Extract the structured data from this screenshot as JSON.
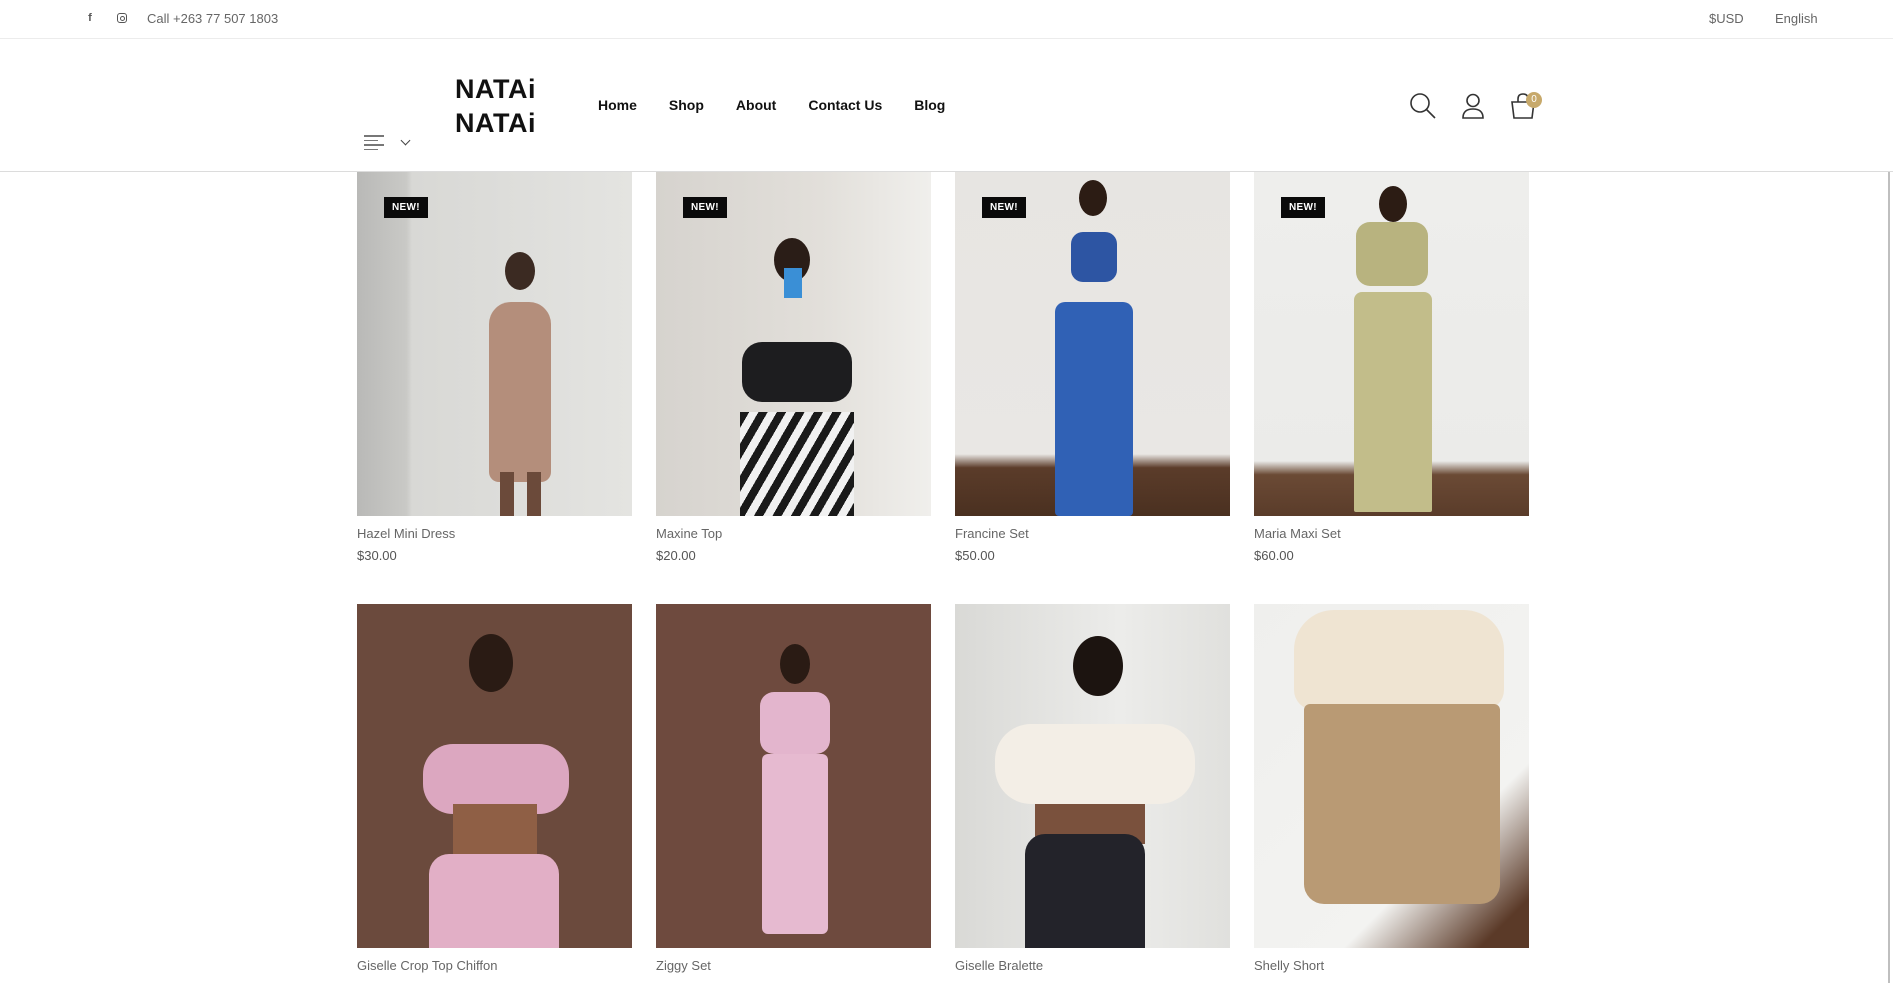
{
  "topbar": {
    "facebook_icon": "facebook-icon",
    "instagram_icon": "instagram-icon",
    "phone": "Call +263 77 507 1803",
    "currency": "$USD",
    "language": "English"
  },
  "header": {
    "logo_line1": "NATAi",
    "logo_line2": "NATAi",
    "nav": [
      "Home",
      "Shop",
      "About",
      "Contact Us",
      "Blog"
    ],
    "cart_count": "0",
    "icons": [
      "search-icon",
      "user-icon",
      "cart-icon",
      "menu-icon",
      "chevron-down-icon"
    ]
  },
  "colors": {
    "badge": "#0a0a0a",
    "cart_badge": "#c7a96b"
  },
  "products": [
    {
      "name": "Hazel Mini Dress",
      "price": "$30.00",
      "badge": "NEW!"
    },
    {
      "name": "Maxine Top",
      "price": "$20.00",
      "badge": "NEW!"
    },
    {
      "name": "Francine Set",
      "price": "$50.00",
      "badge": "NEW!"
    },
    {
      "name": "Maria Maxi Set",
      "price": "$60.00",
      "badge": "NEW!"
    },
    {
      "name": "Giselle Crop Top Chiffon",
      "price": "",
      "badge": ""
    },
    {
      "name": "Ziggy Set",
      "price": "",
      "badge": ""
    },
    {
      "name": "Giselle Bralette",
      "price": "",
      "badge": ""
    },
    {
      "name": "Shelly Short",
      "price": "",
      "badge": ""
    }
  ]
}
